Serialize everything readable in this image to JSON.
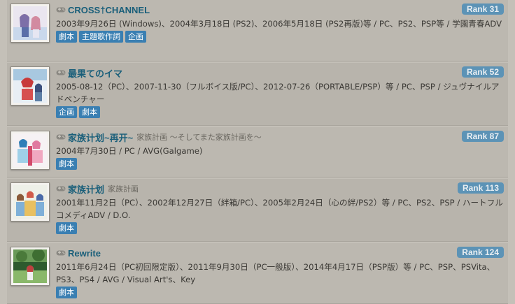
{
  "works": [
    {
      "title": "CROSS†CHANNEL",
      "alt_title": "",
      "rank": "Rank 31",
      "info": "2003年9月26日 (Windows)、2004年3月18日 (PS2)、2006年5月18日 (PS2再版)等 / PC、PS2、PSP等 / 学園青春ADV",
      "tags": [
        "劇本",
        "主題歌作詞",
        "企画"
      ]
    },
    {
      "title": "最果てのイマ",
      "alt_title": "",
      "rank": "Rank 52",
      "info": "2005-08-12（PC）、2007-11-30（フルボイス版/PC）、2012-07-26（PORTABLE/PSP）等 / PC、PSP / ジュヴナイルアドベンチャー",
      "tags": [
        "企画",
        "劇本"
      ]
    },
    {
      "title": "家族计划~再开~",
      "alt_title": "家族計画 ～そしてまた家族計画を～",
      "rank": "Rank 87",
      "info": "2004年7月30日 / PC / AVG(Galgame)",
      "tags": [
        "劇本"
      ]
    },
    {
      "title": "家族计划",
      "alt_title": "家族計画",
      "rank": "Rank 113",
      "info": "2001年11月2日（PC）、2002年12月27日（絆箱/PC）、2005年2月24日（心の絆/PS2）等 / PC、PS2、PSP / ハートフルコメディADV / D.O.",
      "tags": [
        "劇本"
      ]
    },
    {
      "title": "Rewrite",
      "alt_title": "",
      "rank": "Rank 124",
      "info": "2011年6月24日（PC初回限定版）、2011年9月30日（PC一般版）、2014年4月17日（PSP版）等 / PC、PSP、PSVita、PS3、PS4 / AVG / Visual Art's、Key",
      "tags": [
        "劇本"
      ]
    }
  ],
  "icons": {
    "platform": "gamepad-icon"
  }
}
